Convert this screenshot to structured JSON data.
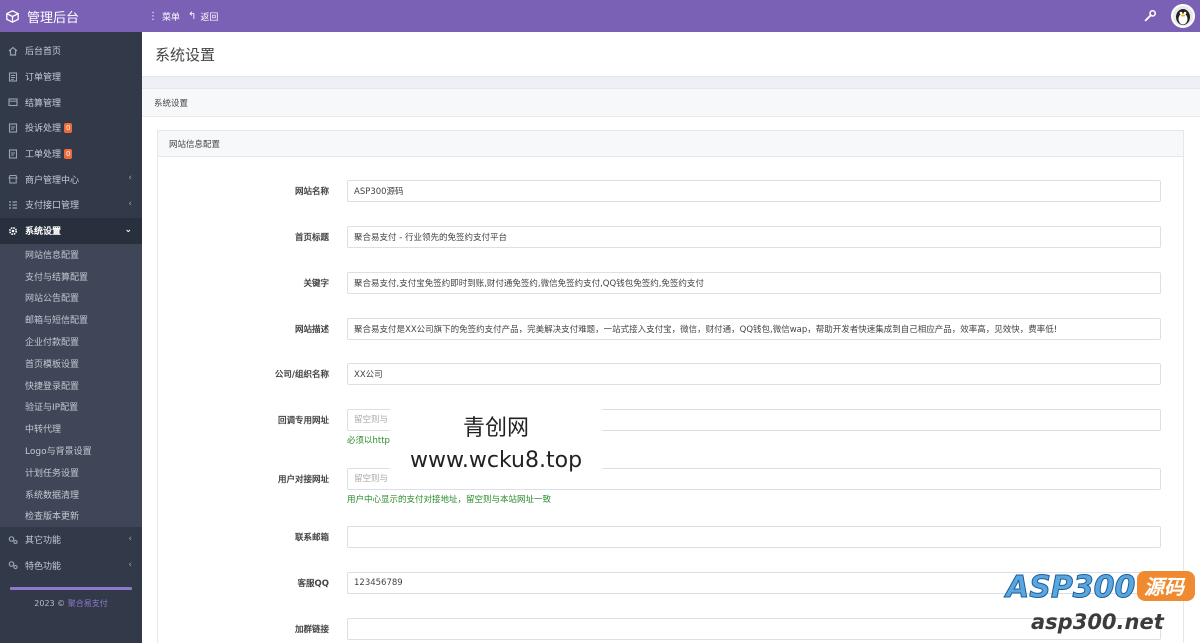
{
  "topbar": {
    "brand_title": "管理后台",
    "menu_label": "菜单",
    "back_label": "返回"
  },
  "sidebar": {
    "items": [
      {
        "label": "后台首页",
        "icon": "home-icon"
      },
      {
        "label": "订单管理",
        "icon": "list-icon"
      },
      {
        "label": "结算管理",
        "icon": "wallet-icon"
      },
      {
        "label": "投诉处理",
        "icon": "complaint-icon",
        "badge": "0"
      },
      {
        "label": "工单处理",
        "icon": "ticket-icon",
        "badge": "0"
      },
      {
        "label": "商户管理中心",
        "icon": "merchant-icon",
        "chevron": "‹"
      },
      {
        "label": "支付接口管理",
        "icon": "grid-icon",
        "chevron": "‹"
      },
      {
        "label": "系统设置",
        "icon": "gear-icon",
        "chevron": "⌄"
      }
    ],
    "sub_items": [
      "网站信息配置",
      "支付与结算配置",
      "网站公告配置",
      "邮箱与短信配置",
      "企业付款配置",
      "首页模板设置",
      "快捷登录配置",
      "验证与IP配置",
      "中转代理",
      "Logo与背景设置",
      "计划任务设置",
      "系统数据清理",
      "检查版本更新"
    ],
    "bottom_items": [
      {
        "label": "其它功能",
        "icon": "gears-icon",
        "chevron": "‹"
      },
      {
        "label": "特色功能",
        "icon": "gears-icon",
        "chevron": "‹"
      }
    ],
    "footer_year": "2023 ©",
    "footer_link": "聚合易支付"
  },
  "page": {
    "title": "系统设置",
    "panel_title": "系统设置",
    "section_title": "网站信息配置"
  },
  "form": {
    "site_name": {
      "label": "网站名称",
      "value": "ASP300源码"
    },
    "home_title": {
      "label": "首页标题",
      "value": "聚合易支付 - 行业领先的免签约支付平台"
    },
    "keywords": {
      "label": "关键字",
      "value": "聚合易支付,支付宝免签约即时到账,财付通免签约,微信免签约支付,QQ钱包免签约,免签约支付"
    },
    "description": {
      "label": "网站描述",
      "value": "聚合易支付是XX公司旗下的免签约支付产品，完美解决支付难题，一站式接入支付宝，微信，财付通，QQ钱包,微信wap，帮助开发者快速集成到自己相应产品，效率高，见效快，费率低!"
    },
    "company": {
      "label": "公司/组织名称",
      "value": "XX公司"
    },
    "callback_url": {
      "label": "回调专用网址",
      "placeholder": "留空则与",
      "help": "必须以http"
    },
    "user_api_url": {
      "label": "用户对接网址",
      "placeholder": "留空则与",
      "help": "用户中心显示的支付对接地址，留空则与本站网址一致"
    },
    "email": {
      "label": "联系邮箱",
      "value": ""
    },
    "qq": {
      "label": "客服QQ",
      "value": "123456789"
    },
    "group_link": {
      "label": "加群链接",
      "value": ""
    }
  },
  "watermark": {
    "line1": "青创网",
    "line2": "www.wcku8.top",
    "logo_text": "ASP300",
    "logo_badge": "源码",
    "logo_url": "asp300.net"
  },
  "colors": {
    "topbar": "#7a61b5",
    "sidebar": "#323a4a",
    "badge": "#ee6b3b",
    "help_text": "#2a8a2a"
  }
}
